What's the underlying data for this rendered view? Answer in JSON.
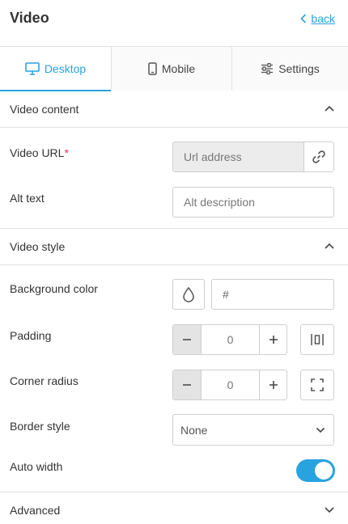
{
  "header": {
    "title": "Video",
    "back_label": "back"
  },
  "tabs": [
    {
      "label": "Desktop",
      "icon": "desktop-icon",
      "active": true
    },
    {
      "label": "Mobile",
      "icon": "mobile-icon",
      "active": false
    },
    {
      "label": "Settings",
      "icon": "sliders-icon",
      "active": false
    }
  ],
  "video_content": {
    "title": "Video content",
    "video_url": {
      "label": "Video URL",
      "required_mark": "*",
      "placeholder": "Url address"
    },
    "alt_text": {
      "label": "Alt text",
      "placeholder": "Alt description"
    }
  },
  "video_style": {
    "title": "Video style",
    "background_color": {
      "label": "Background color",
      "value": "#"
    },
    "padding": {
      "label": "Padding",
      "value": "0",
      "minus": "−",
      "plus": "+"
    },
    "corner_radius": {
      "label": "Corner radius",
      "value": "0",
      "minus": "−",
      "plus": "+"
    },
    "border_style": {
      "label": "Border style",
      "value": "None"
    },
    "auto_width": {
      "label": "Auto width",
      "enabled": true
    }
  },
  "advanced": {
    "title": "Advanced"
  },
  "colors": {
    "accent": "#29a3e0",
    "required": "#e0354f"
  }
}
